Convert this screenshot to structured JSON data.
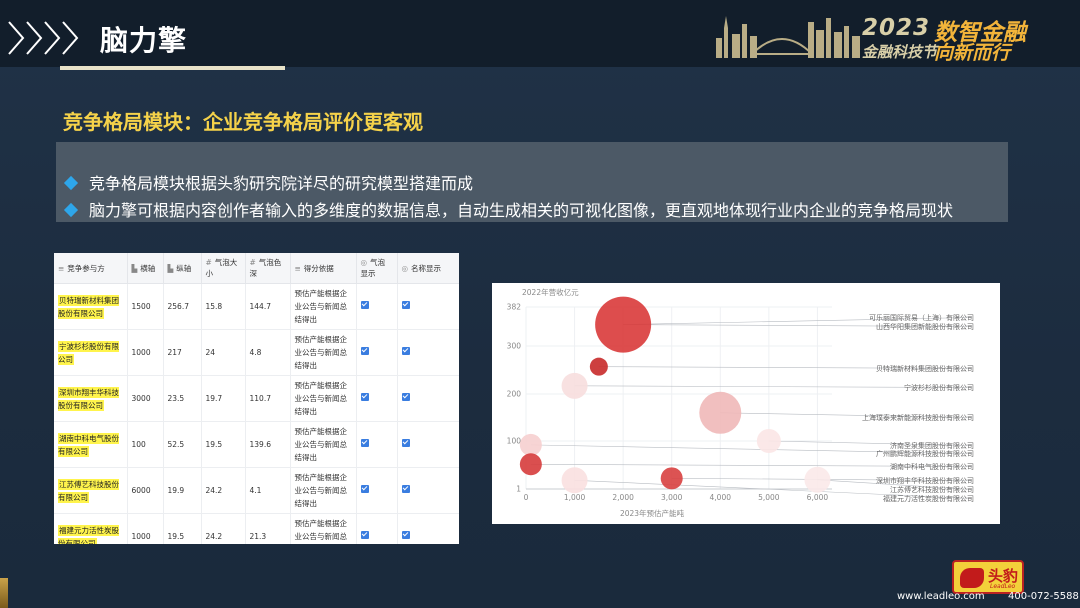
{
  "header": {
    "title": "脑力擎",
    "brand_year": "2023",
    "brand_slogan_top": "数智金融",
    "brand_sub_left": "金融科技节",
    "brand_slogan_bottom": "向新而行"
  },
  "section_title": "竞争格局模块：企业竞争格局评价更客观",
  "bullets": [
    "竞争格局模块根据头豹研究院详尽的研究模型搭建而成",
    "脑力擎可根据内容创作者输入的多维度的数据信息，自动生成相关的可视化图像，更直观地体现行业内企业的竞争格局现状"
  ],
  "table": {
    "headers": [
      "竞争参与方",
      "横轴",
      "纵轴",
      "气泡大小",
      "气泡色深",
      "得分依据",
      "气泡显示",
      "名称显示"
    ],
    "rows": [
      {
        "company": "贝特瑞新材料集团股份有限公司",
        "x": "1500",
        "y": "256.7",
        "size": "15.8",
        "depth": "144.7",
        "basis": "预估产能根据企业公告与新闻总结得出"
      },
      {
        "company": "宁波杉杉股份有限公司",
        "x": "1000",
        "y": "217",
        "size": "24",
        "depth": "4.8",
        "basis": "预估产能根据企业公告与新闻总结得出"
      },
      {
        "company": "深圳市翔丰华科技股份有限公司",
        "x": "3000",
        "y": "23.5",
        "size": "19.7",
        "depth": "110.7",
        "basis": "预估产能根据企业公告与新闻总结得出"
      },
      {
        "company": "湖南中科电气股份有限公司",
        "x": "100",
        "y": "52.5",
        "size": "19.5",
        "depth": "139.6",
        "basis": "预估产能根据企业公告与新闻总结得出"
      },
      {
        "company": "江苏傅艺科技股份有限公司",
        "x": "6000",
        "y": "19.9",
        "size": "24.2",
        "depth": "4.1",
        "basis": "预估产能根据企业公告与新闻总结得出"
      },
      {
        "company": "福建元力活性炭股份有限公司",
        "x": "1000",
        "y": "19.5",
        "size": "24.2",
        "depth": "21.3",
        "basis": "预估产能根据企业公告与新闻总结得出"
      }
    ]
  },
  "chart_data": {
    "type": "scatter",
    "subtype": "bubble",
    "ylabel": "2022年营收亿元",
    "xlabel": "2023年预估产能吨",
    "x_ticks": [
      "0",
      "1,000",
      "2,000",
      "3,000",
      "4,000",
      "5,000",
      "6,000"
    ],
    "y_ticks": [
      "1",
      "100",
      "200",
      "300",
      "382"
    ],
    "xlim": [
      0,
      6300
    ],
    "ylim": [
      1,
      382
    ],
    "points": [
      {
        "name": "可乐丽国际贸易（上海）有限公司",
        "x": 2000,
        "y": 345,
        "r": 28,
        "color": "#d93a3a"
      },
      {
        "name": "山西华阳集团新能股份有限公司",
        "x": 2000,
        "y": 345,
        "r": 0,
        "color": "#d93a3a"
      },
      {
        "name": "贝特瑞新材料集团股份有限公司",
        "x": 1500,
        "y": 257,
        "r": 9,
        "color": "#c82a2a"
      },
      {
        "name": "宁波杉杉股份有限公司",
        "x": 1000,
        "y": 217,
        "r": 13,
        "color": "#f7dede"
      },
      {
        "name": "上海璞泰来新能源科技股份有限公司",
        "x": 4000,
        "y": 160,
        "r": 21,
        "color": "#f0b8b8"
      },
      {
        "name": "济南圣泉集团股份有限公司",
        "x": 5000,
        "y": 100,
        "r": 12,
        "color": "#fbe6e6"
      },
      {
        "name": "广州鹏辉能源科技股份有限公司",
        "x": 100,
        "y": 92,
        "r": 11,
        "color": "#f6cfcf"
      },
      {
        "name": "湖南中科电气股份有限公司",
        "x": 100,
        "y": 52,
        "r": 11,
        "color": "#d63c3c"
      },
      {
        "name": "深圳市翔丰华科技股份有限公司",
        "x": 3000,
        "y": 23,
        "r": 11,
        "color": "#d84040"
      },
      {
        "name": "江苏傅艺科技股份有限公司",
        "x": 6000,
        "y": 20,
        "r": 13,
        "color": "#fbe9e9"
      },
      {
        "name": "福建元力活性炭股份有限公司",
        "x": 1000,
        "y": 19,
        "r": 13,
        "color": "#f9e0e0"
      }
    ]
  },
  "footer": {
    "logo_text": "头豹",
    "logo_sub": "LeadLeo",
    "url": "www.leadleo.com",
    "phone": "400-072-5588"
  },
  "colors": {
    "accent_gold": "#f5d24a",
    "bullet_blue": "#2ea6ea",
    "bubble_red": "#d93a3a"
  }
}
